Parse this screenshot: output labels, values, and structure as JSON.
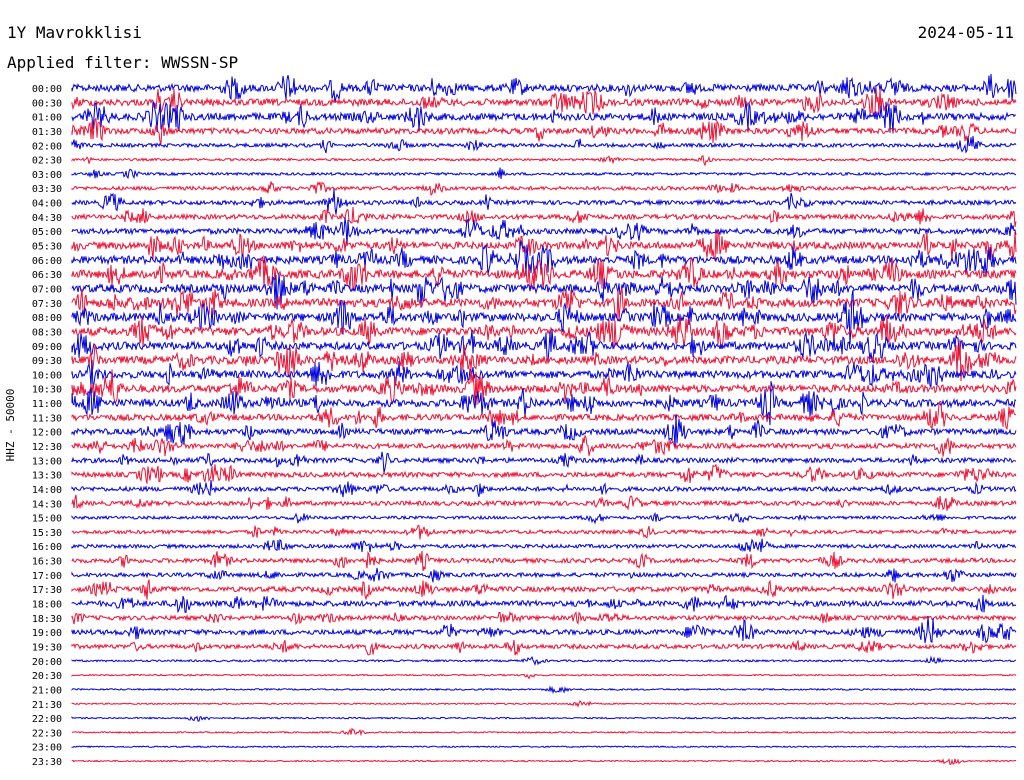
{
  "header": {
    "station": "1Y Mavrokklisi",
    "filter": "Applied filter: WWSSN-SP",
    "date": "2024-05-11"
  },
  "chart_data": {
    "type": "line",
    "title": "1Y Mavrokklisi",
    "ylabel": "HHZ - 50000",
    "row_labels": [
      "00:00",
      "00:30",
      "01:00",
      "01:30",
      "02:00",
      "02:30",
      "03:00",
      "03:30",
      "04:00",
      "04:30",
      "05:00",
      "05:30",
      "06:00",
      "06:30",
      "07:00",
      "07:30",
      "08:00",
      "08:30",
      "09:00",
      "09:30",
      "10:00",
      "10:30",
      "11:00",
      "11:30",
      "12:00",
      "12:30",
      "13:00",
      "13:30",
      "14:00",
      "14:30",
      "15:00",
      "15:30",
      "16:00",
      "16:30",
      "17:00",
      "17:30",
      "18:00",
      "18:30",
      "19:00",
      "19:30",
      "20:00",
      "20:30",
      "21:00",
      "21:30",
      "22:00",
      "22:30",
      "23:00",
      "23:30"
    ],
    "activity": [
      0.85,
      0.8,
      0.85,
      0.65,
      0.35,
      0.15,
      0.2,
      0.35,
      0.45,
      0.5,
      0.6,
      0.85,
      0.95,
      1.0,
      1.0,
      1.0,
      1.0,
      1.0,
      0.95,
      0.95,
      0.9,
      0.9,
      0.9,
      0.7,
      0.65,
      0.55,
      0.5,
      0.55,
      0.45,
      0.45,
      0.25,
      0.35,
      0.35,
      0.45,
      0.4,
      0.55,
      0.6,
      0.45,
      0.55,
      0.45,
      0.1,
      0.03,
      0.05,
      0.03,
      0.03,
      0.03,
      0.02,
      0.03
    ],
    "colors": [
      "#0000dd",
      "#ee1133"
    ]
  }
}
